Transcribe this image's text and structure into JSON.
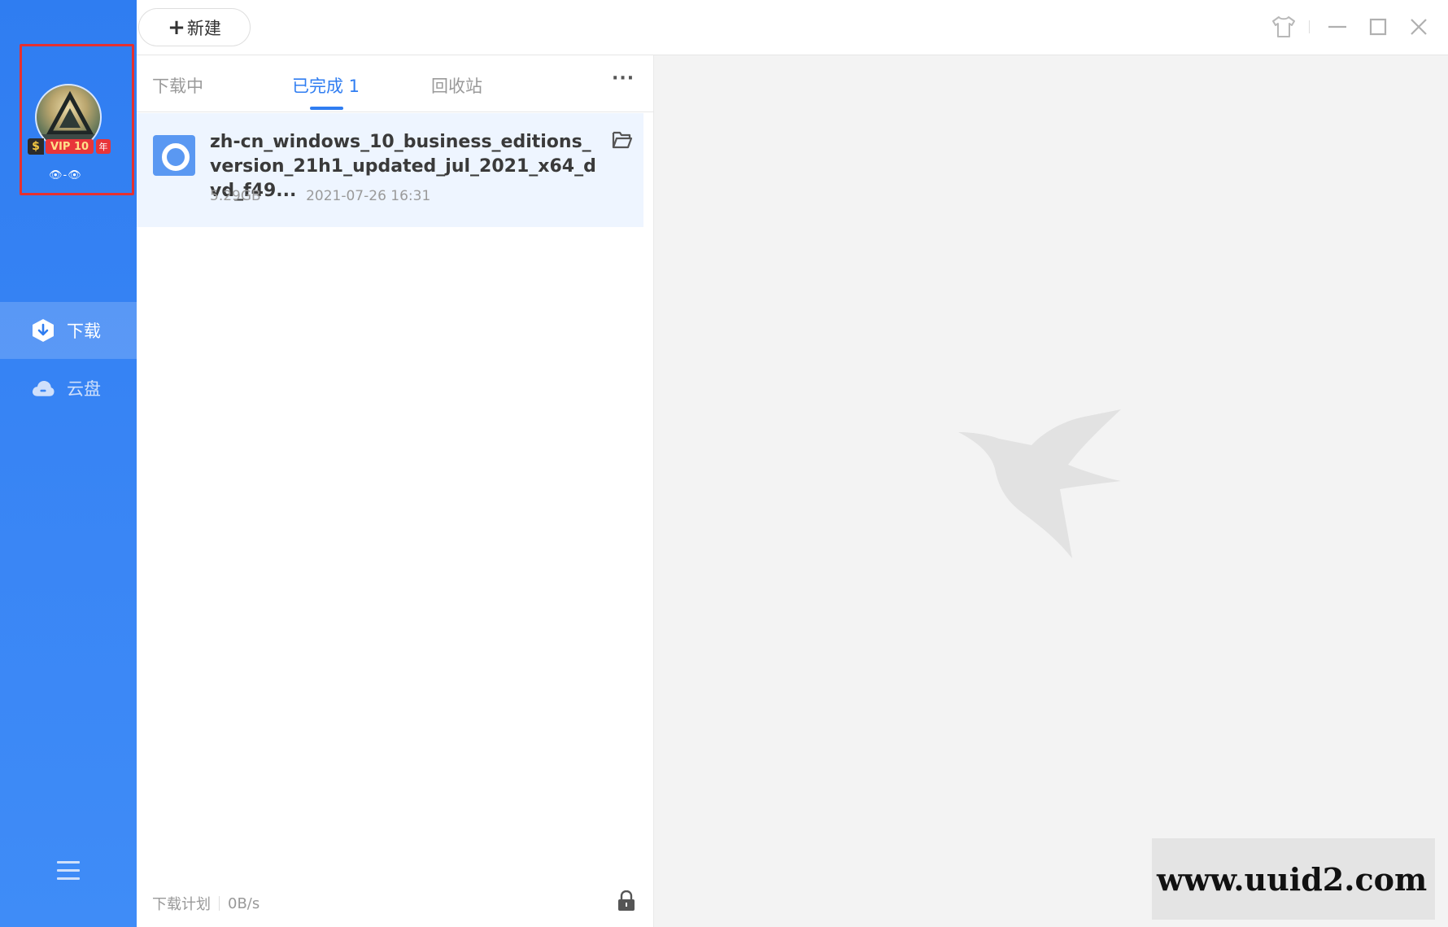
{
  "sidebar": {
    "profile": {
      "vip_symbol": "$",
      "vip_label": "VIP 10",
      "vip_year": "年",
      "nickname": "👁-👁"
    },
    "nav": [
      {
        "label": "下载",
        "icon": "download-shield-icon",
        "active": true
      },
      {
        "label": "云盘",
        "icon": "cloud-icon",
        "active": false
      }
    ],
    "menu_icon": "hamburger-menu-icon"
  },
  "toolbar": {
    "new_label": "新建",
    "new_plus": "+",
    "controls": [
      "skin-icon",
      "minimize-icon",
      "maximize-icon",
      "close-icon"
    ]
  },
  "list": {
    "tabs": [
      {
        "label": "下载中",
        "active": false
      },
      {
        "label": "已完成 1",
        "active": true
      },
      {
        "label": "回收站",
        "active": false
      }
    ],
    "more_label": "···",
    "files": [
      {
        "name": "zh-cn_windows_10_business_editions_version_21h1_updated_jul_2021_x64_dvd_f49...",
        "size": "5.29GB",
        "date": "2021-07-26 16:31",
        "icon": "disc-image-icon"
      }
    ],
    "footer": {
      "plan_label": "下载计划",
      "speed": "0B/s"
    }
  },
  "watermark": "www.uuid2.com",
  "colors": {
    "accent": "#2f7df1",
    "sidebar": "#3a86f5",
    "highlight_row": "#eef5ff",
    "profile_border": "#e53030"
  }
}
